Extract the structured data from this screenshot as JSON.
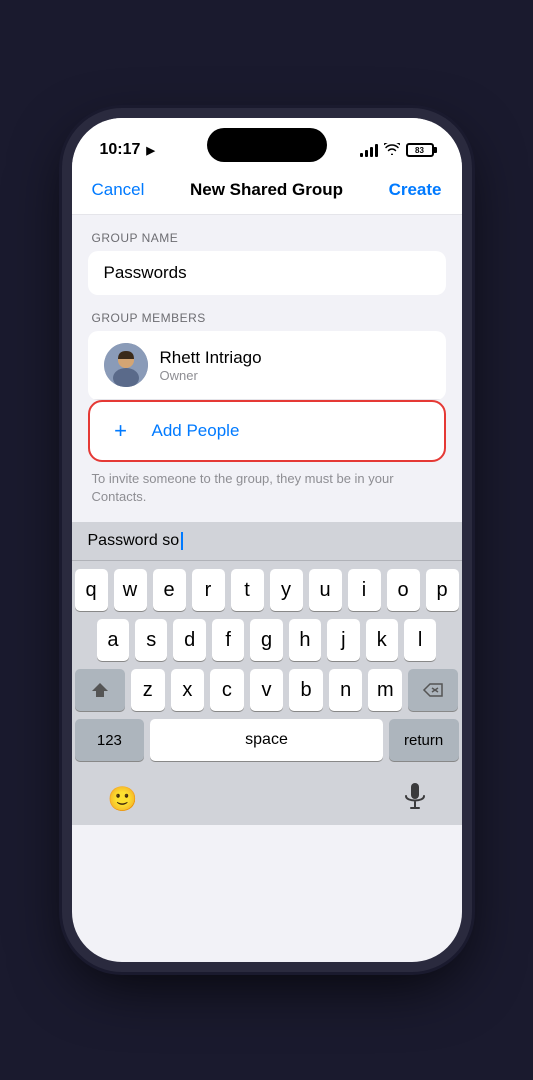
{
  "status_bar": {
    "time": "10:17",
    "location_arrow": "➤",
    "battery_level": "83"
  },
  "nav": {
    "cancel_label": "Cancel",
    "title": "New Shared Group",
    "create_label": "Create"
  },
  "form": {
    "group_name_section_label": "GROUP NAME",
    "group_name_value": "Passwords",
    "group_members_section_label": "GROUP MEMBERS"
  },
  "member": {
    "name": "Rhett Intriago",
    "role": "Owner"
  },
  "add_people": {
    "label": "Add People",
    "plus": "+"
  },
  "hint": {
    "text": "To invite someone to the group, they must be in your Contacts."
  },
  "keyboard_suggestion": {
    "text": "Password so"
  },
  "keyboard": {
    "rows": [
      [
        "q",
        "w",
        "e",
        "r",
        "t",
        "y",
        "u",
        "i",
        "o",
        "p"
      ],
      [
        "a",
        "s",
        "d",
        "f",
        "g",
        "h",
        "j",
        "k",
        "l"
      ],
      [
        "z",
        "x",
        "c",
        "v",
        "b",
        "n",
        "m"
      ],
      [
        "123",
        "space",
        "return"
      ]
    ],
    "space_label": "space",
    "return_label": "return",
    "num_label": "123"
  },
  "bottom_bar": {
    "emoji_icon": "😊",
    "mic_icon": "🎤"
  }
}
